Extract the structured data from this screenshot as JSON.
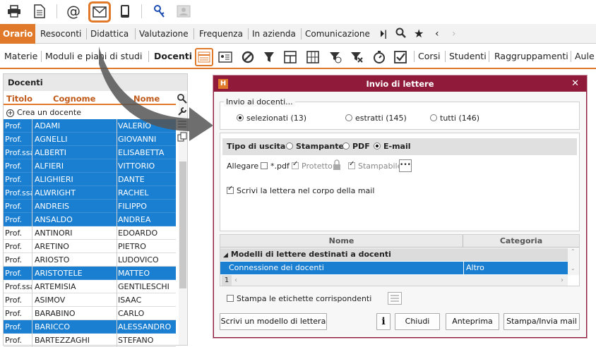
{
  "toolbar": {
    "icons": [
      "print-icon",
      "document-icon",
      "at-email-icon",
      "envelope-icon",
      "tablet-icon",
      "key-icon",
      "contact-card-icon"
    ]
  },
  "menu": {
    "items": [
      "Orario",
      "Resoconti",
      "Didattica",
      "Valutazione",
      "Frequenza",
      "In azienda",
      "Comunicazione"
    ]
  },
  "sub": {
    "items": [
      "Materie",
      "Moduli e piani di studi",
      "Docenti",
      "Corsi",
      "Studenti",
      "Raggruppamenti",
      "Aule"
    ]
  },
  "list": {
    "title": "Docenti",
    "headers": {
      "title": "Titolo",
      "surname": "Cognome",
      "name": "Nome"
    },
    "create_label": "Crea un docente",
    "rows": [
      {
        "t": "Prof.",
        "s": "ADAMI",
        "n": "VALERIO",
        "sel": true
      },
      {
        "t": "Prof.",
        "s": "AGNELLI",
        "n": "GIOVANNI",
        "sel": true
      },
      {
        "t": "Prof.ssa",
        "s": "ALBERTI",
        "n": "ELISABETTA",
        "sel": true
      },
      {
        "t": "Prof.",
        "s": "ALFIERI",
        "n": "VITTORIO",
        "sel": true
      },
      {
        "t": "Prof.",
        "s": "ALIGHIERI",
        "n": "DANTE",
        "sel": true
      },
      {
        "t": "Prof.ssa",
        "s": "ALWRIGHT",
        "n": "RACHEL",
        "sel": true
      },
      {
        "t": "Prof.",
        "s": "ANDREIS",
        "n": "FILIPPO",
        "sel": true
      },
      {
        "t": "Prof.",
        "s": "ANSALDO",
        "n": "ANDREA",
        "sel": true
      },
      {
        "t": "Prof.",
        "s": "ANTINORI",
        "n": "EDOARDO",
        "sel": false
      },
      {
        "t": "Prof.",
        "s": "ARETINO",
        "n": "PIETRO",
        "sel": false
      },
      {
        "t": "Prof.",
        "s": "ARIOSTO",
        "n": "LUDOVICO",
        "sel": false
      },
      {
        "t": "Prof.",
        "s": "ARISTOTELE",
        "n": "MATTEO",
        "sel": true
      },
      {
        "t": "Prof.ssa",
        "s": "ARTEMISIA",
        "n": "GENTILESCHI",
        "sel": false
      },
      {
        "t": "Prof.",
        "s": "ASIMOV",
        "n": "ISAAC",
        "sel": false
      },
      {
        "t": "Prof.",
        "s": "BARABINO",
        "n": "CARLO",
        "sel": false
      },
      {
        "t": "Prof.",
        "s": "BARICCO",
        "n": "ALESSANDRO",
        "sel": true
      },
      {
        "t": "Prof.",
        "s": "BARTEZZAGHI",
        "n": "STEFANO",
        "sel": false
      }
    ]
  },
  "dialog": {
    "title": "Invio di lettere",
    "close": "✕",
    "send_group": "Invio ai docenti...",
    "opt_selected": "selezionati (13)",
    "opt_extracted": "estratti (145)",
    "opt_all": "tutti (146)",
    "output_label": "Tipo di uscita :",
    "out_printer": "Stampante",
    "out_pdf": "PDF",
    "out_email": "E-mail",
    "attach_label": "Allegare",
    "attach_pdf": "*.pdf",
    "attach_protected": "Protetto",
    "attach_printable": "Stampabile",
    "more": "•••",
    "write_in_body": "Scrivi la lettera nel corpo della mail",
    "col_name": "Nome",
    "col_category": "Categoria",
    "group_row": "Modelli di lettere destinati a docenti",
    "letter_row_name": "Connessione dei docenti",
    "letter_row_cat": "Altro",
    "page_num": "1",
    "print_labels": "Stampa le etichette corrispondenti",
    "btn_write_model": "Scrivi un modello di lettera",
    "btn_info": "i",
    "btn_close": "Chiudi",
    "btn_preview": "Anteprima",
    "btn_print_send": "Stampa/Invia mail"
  }
}
